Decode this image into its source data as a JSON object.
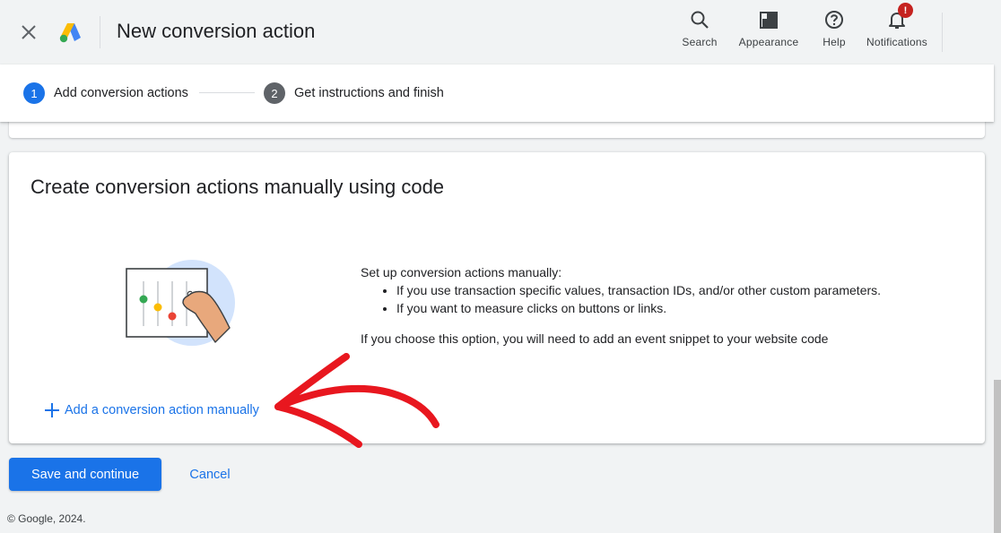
{
  "header": {
    "title": "New conversion action",
    "close_icon": "close-icon",
    "logo_icon": "google-ads-logo",
    "tools": [
      {
        "label": "Search",
        "icon": "search-icon"
      },
      {
        "label": "Appearance",
        "icon": "appearance-icon"
      },
      {
        "label": "Help",
        "icon": "help-icon"
      },
      {
        "label": "Notifications",
        "icon": "bell-icon",
        "badge": "!"
      }
    ]
  },
  "stepper": {
    "steps": [
      {
        "number": "1",
        "label": "Add conversion actions",
        "state": "active",
        "color": "#1a73e8"
      },
      {
        "number": "2",
        "label": "Get instructions and finish",
        "state": "inactive",
        "color": "#5f6368"
      }
    ]
  },
  "card": {
    "title": "Create conversion actions manually using code",
    "intro": "Set up conversion actions manually:",
    "bullets": [
      "If you use transaction specific values, transaction IDs, and/or other custom parameters.",
      "If you want to measure clicks on buttons or links."
    ],
    "note": "If you choose this option, you will need to add an event snippet to your website code",
    "add_link": "Add a conversion action manually",
    "illustration_icon": "sliders-hand-illustration"
  },
  "actions": {
    "primary": "Save and continue",
    "cancel": "Cancel"
  },
  "footer": {
    "copyright": "© Google, 2024."
  },
  "colors": {
    "accent": "#1a73e8",
    "annotation": "#e8171f",
    "badge": "#c5221f"
  }
}
